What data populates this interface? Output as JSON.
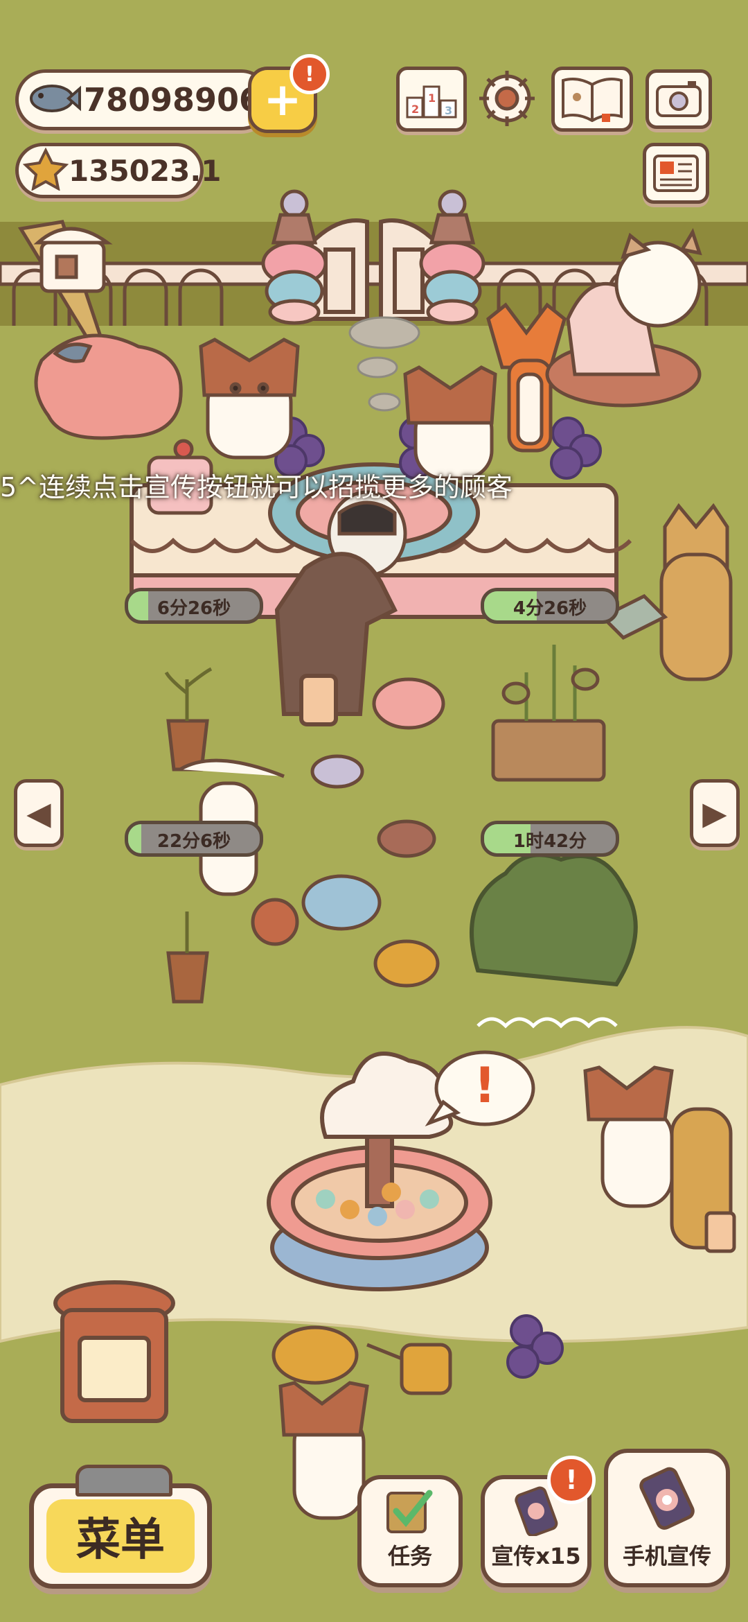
{
  "hud": {
    "fish_count": "78098906",
    "star_count": "135023.1",
    "add_badge": "!"
  },
  "tip_text": "5^连续点击宣传按钮就可以招揽更多的顾客",
  "timers": [
    {
      "label": "6分26秒",
      "progress": 0.15
    },
    {
      "label": "4分26秒",
      "progress": 0.4
    },
    {
      "label": "22分6秒",
      "progress": 0.1
    },
    {
      "label": "1时42分",
      "progress": 0.35
    }
  ],
  "bottom_bar": {
    "menu_label": "菜单",
    "task_label": "任务",
    "promo_label": "宣传x15",
    "promo_badge": "!",
    "phone_promo_label": "手机宣传"
  },
  "fountain_bubble": "!",
  "colors": {
    "grass": "#a9ad57",
    "path": "#ece3bc",
    "outline": "#6b4a3a",
    "badge": "#e2582c",
    "menu_button": "#f7d85a"
  }
}
